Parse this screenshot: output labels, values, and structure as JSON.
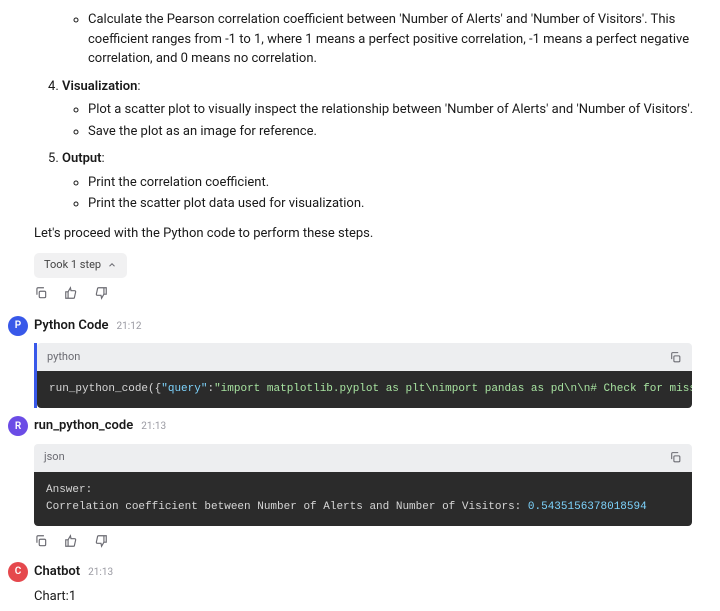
{
  "steps": {
    "s3_bullets": [
      "Calculate the Pearson correlation coefficient between 'Number of Alerts' and 'Number of Visitors'. This coefficient ranges from -1 to 1, where 1 means a perfect positive correlation, -1 means a perfect negative correlation, and 0 means no correlation."
    ],
    "s4_title": "Visualization",
    "s4_bullets": [
      "Plot a scatter plot to visually inspect the relationship between 'Number of Alerts' and 'Number of Visitors'.",
      "Save the plot as an image for reference."
    ],
    "s5_title": "Output",
    "s5_bullets": [
      "Print the correlation coefficient.",
      "Print the scatter plot data used for visualization."
    ]
  },
  "lead": "Let's proceed with the Python code to perform these steps.",
  "took_step": "Took 1 step",
  "python_code_msg": {
    "avatar": "P",
    "sender": "Python Code",
    "ts": "21:12",
    "lang": "python",
    "code_fn": "run_python_code",
    "code_key": "\"query\"",
    "code_str": "\"import matplotlib.pyplot as plt\\nimport pandas as pd\\n\\n# Check for missing"
  },
  "run_msg": {
    "avatar": "R",
    "sender": "run_python_code",
    "ts": "21:13",
    "lang": "json",
    "answer_line": "Answer:",
    "corr_prefix": "Correlation coefficient between Number of Alerts and Number of Visitors: ",
    "corr_value": "0.5435156378018594"
  },
  "chatbot_msg": {
    "avatar": "C",
    "sender": "Chatbot",
    "ts": "21:13",
    "body": "Chart:1"
  },
  "colon": ":"
}
